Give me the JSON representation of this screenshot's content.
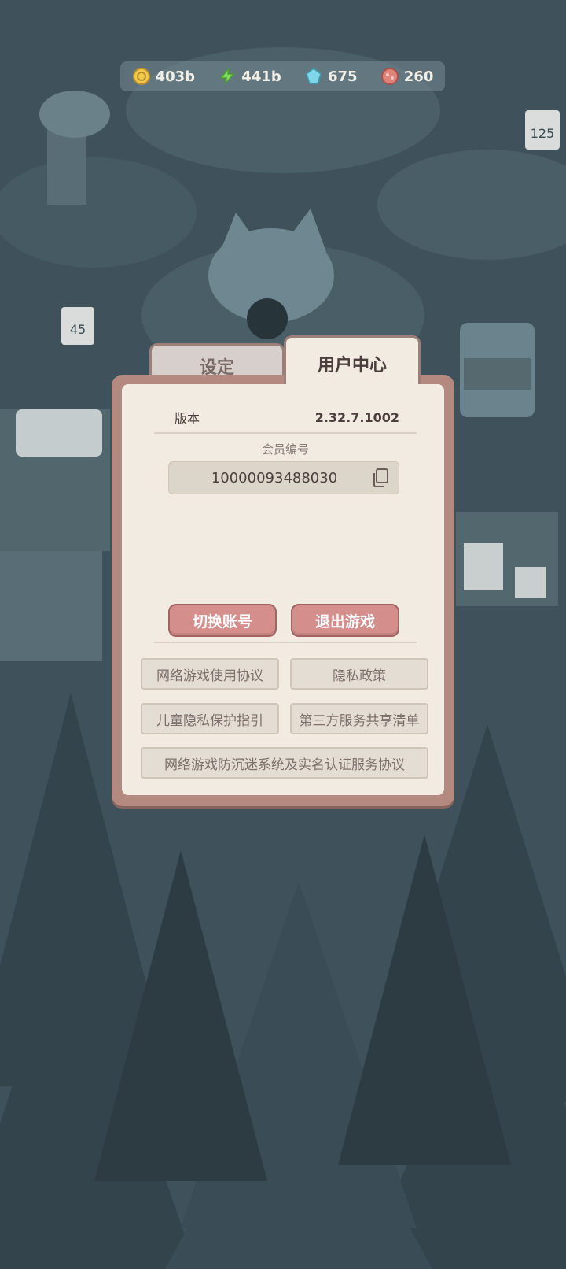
{
  "resources": [
    {
      "name": "gold-coin-icon",
      "value": "403b",
      "color": "#f2c94c"
    },
    {
      "name": "energy-bolt-icon",
      "value": "441b",
      "color": "#7ddc5a"
    },
    {
      "name": "blue-gem-icon",
      "value": "675",
      "color": "#7ed6e8"
    },
    {
      "name": "red-bead-icon",
      "value": "260",
      "color": "#e0837a"
    }
  ],
  "background_signs": [
    "125",
    "45"
  ],
  "tabs": {
    "settings": "设定",
    "user_center": "用户中心"
  },
  "version": {
    "label": "版本",
    "value": "2.32.7.1002"
  },
  "member": {
    "label": "会员编号",
    "number": "10000093488030"
  },
  "buttons": {
    "switch_account": "切换账号",
    "exit_game": "退出游戏"
  },
  "docs": {
    "terms": "网络游戏使用协议",
    "privacy": "隐私政策",
    "child_privacy": "儿童隐私保护指引",
    "third_party": "第三方服务共享清单",
    "anti_addiction": "网络游戏防沉迷系统及实名认证服务协议"
  },
  "colors": {
    "accent": "#d48e8b",
    "panel": "#f1ebe2",
    "frame": "#b38980"
  }
}
